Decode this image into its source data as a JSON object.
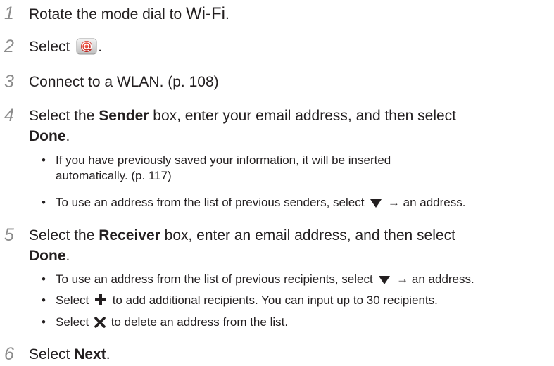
{
  "steps": [
    {
      "num": "1",
      "pre": "Rotate the mode dial to ",
      "mode": "Wi-Fi",
      "post": "."
    },
    {
      "num": "2",
      "pre": "Select ",
      "post": "."
    },
    {
      "num": "3",
      "text": "Connect to a WLAN. (p. 108)"
    },
    {
      "num": "4",
      "pre": "Select the ",
      "bold1": "Sender",
      "mid": " box, enter your email address, and then select",
      "bold2": "Done",
      "post": ".",
      "bullets": [
        {
          "line1": "If you have previously saved your information, it will be inserted",
          "line2": "automatically. (p. 117)"
        },
        {
          "pre": "To use an address from the list of previous senders, select ",
          "post": " → an address.",
          "icon": "down-triangle-icon"
        }
      ]
    },
    {
      "num": "5",
      "pre": "Select the ",
      "bold1": "Receiver",
      "mid": " box, enter an email address, and then select",
      "bold2": "Done",
      "post": ".",
      "bullets": [
        {
          "pre": "To use an address from the list of previous recipients, select ",
          "post": " → an address.",
          "icon": "down-triangle-icon"
        },
        {
          "pre": "Select ",
          "post": " to add additional recipients. You can input up to 30 recipients.",
          "icon": "plus-icon"
        },
        {
          "pre": "Select ",
          "post": " to delete an address from the list.",
          "icon": "x-icon"
        }
      ]
    },
    {
      "num": "6",
      "pre": "Select ",
      "bold": "Next",
      "post": "."
    }
  ],
  "bullet_char": "•",
  "icons": {
    "mail": "email-icon",
    "triangle": "down-triangle-icon",
    "plus": "plus-icon",
    "x": "x-icon"
  }
}
